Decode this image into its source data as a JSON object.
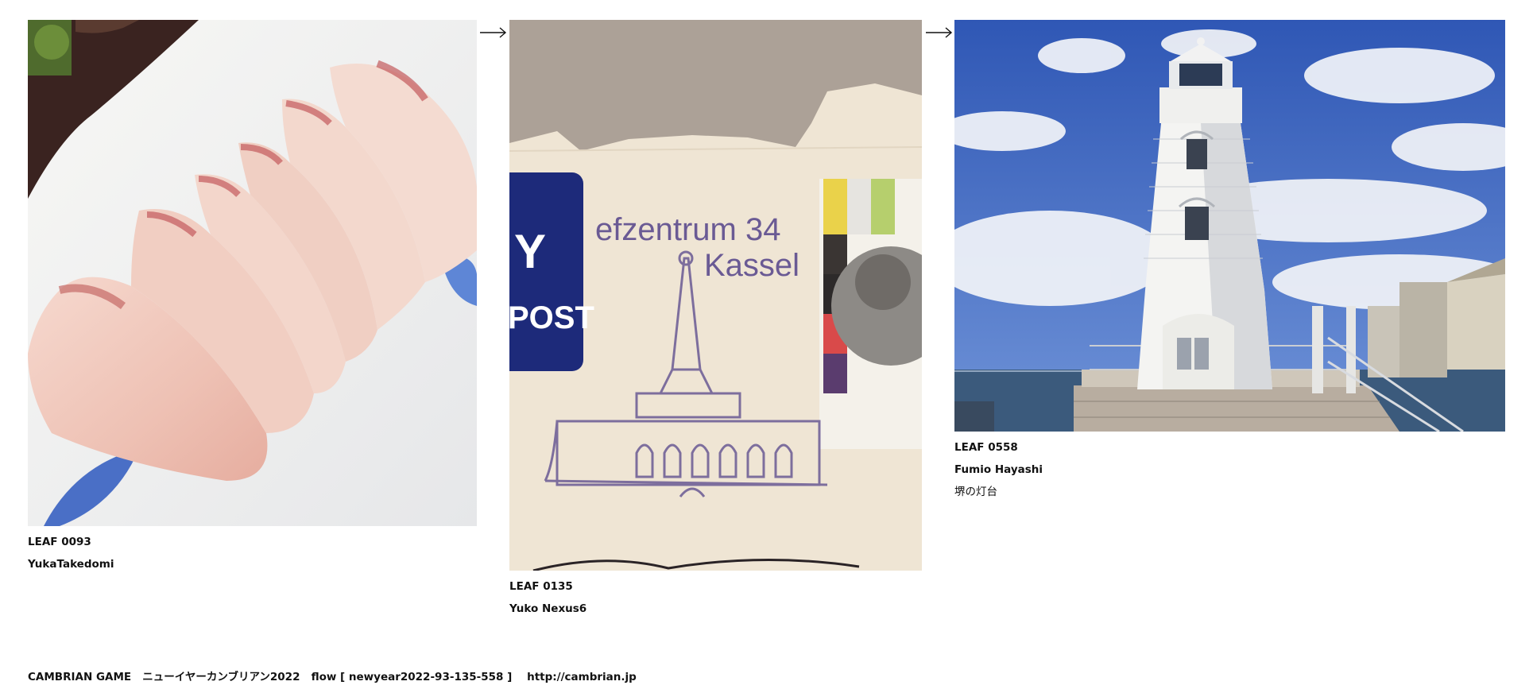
{
  "leaves": [
    {
      "code": "LEAF 0093",
      "author": "YukaTakedomi",
      "image_description": "sliced raw fish sashimi on a white plate with blue leaf pattern"
    },
    {
      "code": "LEAF 0135",
      "author": "Yuko Nexus6",
      "stamp_text_line1": "efzentrum 34",
      "stamp_text_line2": "Kassel",
      "envelope_logo_text1": "Y",
      "envelope_logo_text2": "POST",
      "image_description": "postmark of a tower on an envelope with a stamp"
    },
    {
      "code": "LEAF 0558",
      "author": "Fumio Hayashi",
      "title": "堺の灯台",
      "image_description": "white wooden lighthouse by the sea under a blue sky"
    }
  ],
  "arrows": [
    "→",
    "→"
  ],
  "footer": {
    "game": "CAMBRIAN GAME",
    "title": "ニューイヤーカンブリアン2022",
    "flow": "flow [ newyear2022-93-135-558 ]",
    "url": "http://cambrian.jp"
  },
  "colors": {
    "text": "#111111",
    "background": "#ffffff",
    "sky": "#3f66c4",
    "postbox_blue": "#1d2a7a",
    "stamp_ink": "#6a5a94",
    "envelope": "#efe5d4"
  }
}
